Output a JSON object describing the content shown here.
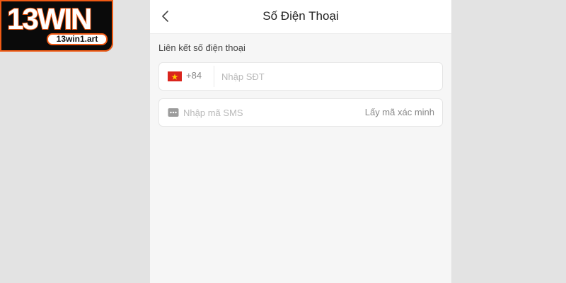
{
  "watermark": {
    "brand": "13WIN",
    "domain": "13win1.art",
    "brand_color": "#f05a14"
  },
  "header": {
    "title": "Số Điện Thoại",
    "back_icon": "chevron-left-icon"
  },
  "form": {
    "section_label": "Liên kết số điện thoại",
    "phone": {
      "country_flag": "vietnam-flag-icon",
      "dial_code": "+84",
      "value": "",
      "placeholder": "Nhập SĐT"
    },
    "sms": {
      "icon": "sms-dots-icon",
      "value": "",
      "placeholder": "Nhập mã SMS",
      "get_code_label": "Lấy mã xác minh"
    }
  }
}
